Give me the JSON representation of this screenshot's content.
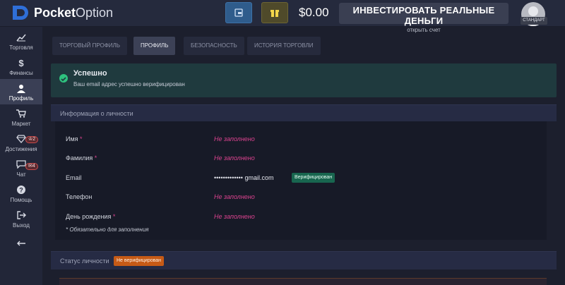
{
  "header": {
    "brand": "Pocket",
    "brand_suffix": "Option",
    "balance": "$0.00",
    "invest_title": "ИНВЕСТИРОВАТЬ РЕАЛЬНЫЕ ДЕНЬГИ",
    "invest_subtitle": "открыть счет",
    "avatar_badge": "СТАНДАРТ",
    "brand_color": "#2f6fd8"
  },
  "sidebar": {
    "items": [
      {
        "label": "Торговля",
        "icon": "chart-icon"
      },
      {
        "label": "Финансы",
        "icon": "dollar-icon"
      },
      {
        "label": "Профиль",
        "icon": "user-icon"
      },
      {
        "label": "Маркет",
        "icon": "cart-icon"
      },
      {
        "label": "Достижения",
        "icon": "diamond-icon",
        "badge": "2"
      },
      {
        "label": "Чат",
        "icon": "chat-icon",
        "badge": "4"
      },
      {
        "label": "Помощь",
        "icon": "help-icon"
      },
      {
        "label": "Выход",
        "icon": "logout-icon"
      }
    ]
  },
  "tabs": [
    {
      "label": "ТОРГОВЫЙ ПРОФИЛЬ"
    },
    {
      "label": "ПРОФИЛЬ"
    },
    {
      "label": "БЕЗОПАСНОСТЬ"
    },
    {
      "label": "ИСТОРИЯ ТОРГОВЛИ"
    }
  ],
  "success": {
    "title": "Успешно",
    "message": "Ваш email адрес успешно верифицирован"
  },
  "personal": {
    "title": "Информация о личности",
    "rows": [
      {
        "label": "Имя",
        "required": "*",
        "value": "Не заполнено"
      },
      {
        "label": "Фамилия",
        "required": "*",
        "value": "Не заполнено"
      },
      {
        "label": "Email",
        "required": "",
        "value": "••••••••••••• gmail.com",
        "badge": "Верифицирован"
      },
      {
        "label": "Телефон",
        "required": "",
        "value": "Не заполнено"
      },
      {
        "label": "День рождения",
        "required": "*",
        "value": "Не заполнено"
      }
    ],
    "required_note": "* Обязательно для заполнения"
  },
  "status": {
    "title": "Статус личности",
    "badge": "Не верифицирован"
  }
}
